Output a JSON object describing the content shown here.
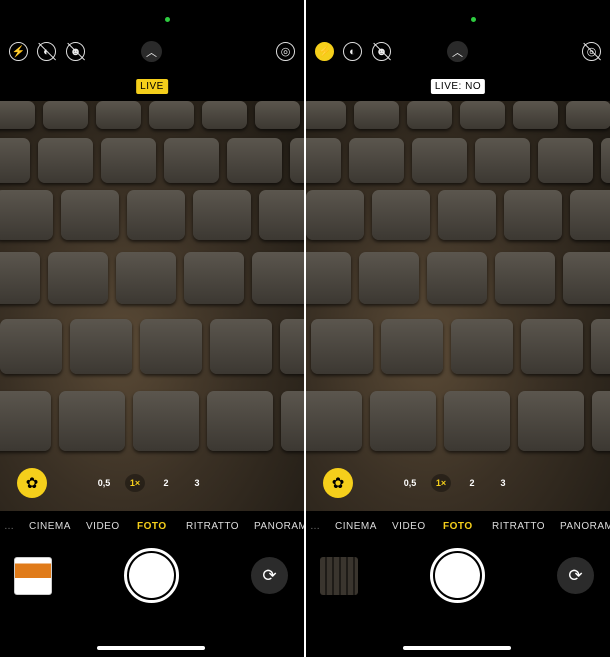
{
  "screens": [
    {
      "flash": "auto",
      "live_badge": "LIVE",
      "live_on": true,
      "zoom_levels": [
        "0,5",
        "1×",
        "2",
        "3"
      ],
      "zoom_selected": 1,
      "modes": [
        "…",
        "CINEMA",
        "VIDEO",
        "FOTO",
        "RITRATTO",
        "PANORAMICA"
      ],
      "mode_selected": "FOTO",
      "thumbnail": "app-screenshot"
    },
    {
      "flash": "on",
      "live_badge": "LIVE: NO",
      "live_on": false,
      "zoom_levels": [
        "0,5",
        "1×",
        "2",
        "3"
      ],
      "zoom_selected": 1,
      "modes": [
        "…",
        "CINEMA",
        "VIDEO",
        "FOTO",
        "RITRATTO",
        "PANORAMICA"
      ],
      "mode_selected": "FOTO",
      "thumbnail": "keyboard-photo"
    }
  ],
  "colors": {
    "accent": "#f5cf1b",
    "status_dot": "#2ecc40"
  }
}
